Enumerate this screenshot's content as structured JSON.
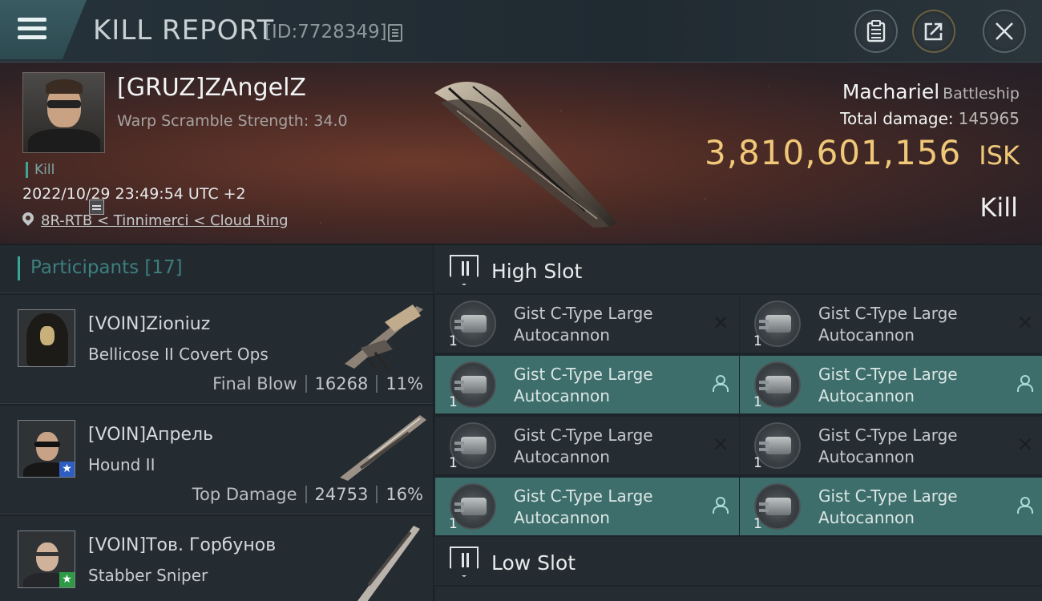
{
  "header": {
    "title": "KILL REPORT",
    "report_id": "[ID:7728349]",
    "menu_icon": "hamburger-menu-icon",
    "buttons": {
      "clipboard_icon": "clipboard-icon",
      "share_icon": "share-icon",
      "close_icon": "close-icon"
    }
  },
  "victim": {
    "name": "[GRUZ]ZAngelZ",
    "subtitle": "Warp Scramble Strength: 34.0",
    "tag": "Kill",
    "timestamp": "2022/10/29 23:49:54 UTC +2",
    "location": "8R-RTB < Tinnimerci < Cloud Ring",
    "ship_name": "Machariel",
    "ship_class": "Battleship",
    "total_damage_label": "Total damage:",
    "total_damage": "145965",
    "isk_value": "3,810,601,156",
    "isk_unit": "ISK",
    "result": "Kill"
  },
  "participants": {
    "title": "Participants [17]",
    "items": [
      {
        "name": "[VOIN]Zioniuz",
        "ship": "Bellicose II Covert Ops",
        "role": "Final Blow",
        "damage": "16268",
        "percent": "11%",
        "badge": ""
      },
      {
        "name": "[VOIN]Апрель",
        "ship": "Hound II",
        "role": "Top Damage",
        "damage": "24753",
        "percent": "16%",
        "badge": "star-blue"
      },
      {
        "name": "[VOIN]Тов. Горбунов",
        "ship": "Stabber Sniper",
        "role": "",
        "damage": "",
        "percent": "",
        "badge": "star-green"
      }
    ]
  },
  "fittings": {
    "high_slot_title": "High Slot",
    "low_slot_title": "Low Slot",
    "high_modules": [
      {
        "line1": "Gist C-Type Large",
        "line2": "Autocannon",
        "qty": "1",
        "status": "destroyed"
      },
      {
        "line1": "Gist C-Type Large",
        "line2": "Autocannon",
        "qty": "1",
        "status": "destroyed"
      },
      {
        "line1": "Gist C-Type Large",
        "line2": "Autocannon",
        "qty": "1",
        "status": "dropped"
      },
      {
        "line1": "Gist C-Type Large",
        "line2": "Autocannon",
        "qty": "1",
        "status": "dropped"
      },
      {
        "line1": "Gist C-Type Large",
        "line2": "Autocannon",
        "qty": "1",
        "status": "destroyed"
      },
      {
        "line1": "Gist C-Type Large",
        "line2": "Autocannon",
        "qty": "1",
        "status": "destroyed"
      },
      {
        "line1": "Gist C-Type Large",
        "line2": "Autocannon",
        "qty": "1",
        "status": "dropped"
      },
      {
        "line1": "Gist C-Type Large",
        "line2": "Autocannon",
        "qty": "1",
        "status": "dropped"
      }
    ]
  },
  "colors": {
    "accent_teal": "#36a99a",
    "isk_gold": "#f0c878",
    "dropped_bg": "#3e6e6b"
  }
}
